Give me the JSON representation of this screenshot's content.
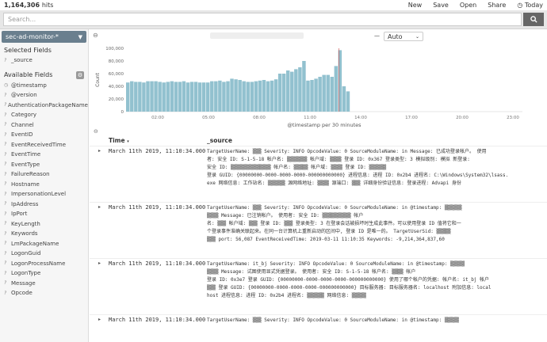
{
  "topbar": {
    "hits_count": "1,164,306",
    "hits_label": "hits",
    "menu": [
      "New",
      "Save",
      "Open",
      "Share"
    ],
    "time_label": "Today"
  },
  "search": {
    "placeholder": "Search..."
  },
  "sidebar": {
    "index_pattern": "sec-ad-monitor-*",
    "selected_heading": "Selected Fields",
    "selected_fields": [
      "_source"
    ],
    "available_heading": "Available Fields",
    "fields": [
      "@timestamp",
      "@version",
      "AuthenticationPackageName",
      "Category",
      "Channel",
      "EventID",
      "EventReceivedTime",
      "EventTime",
      "EventType",
      "FailureReason",
      "Hostname",
      "ImpersonationLevel",
      "IpAddress",
      "IpPort",
      "KeyLength",
      "Keywords",
      "LmPackageName",
      "LogonGuid",
      "LogonProcessName",
      "LogonType",
      "Message",
      "Opcode"
    ]
  },
  "toolbar": {
    "interval": "Auto"
  },
  "chart_data": {
    "type": "bar",
    "ylabel": "Count",
    "xlabel": "@timestamp per 30 minutes",
    "ylim": [
      0,
      100000
    ],
    "yticks": [
      "100,000",
      "80,000",
      "60,000",
      "40,000",
      "20,000",
      "0"
    ],
    "xticks": [
      "12:00",
      "14:00",
      "16:00",
      "18:00",
      "20:00",
      "22:00",
      "00:00",
      "02:00",
      "04:00",
      "06:00",
      "08:00",
      "10:00"
    ],
    "xtick_labels_shown": [
      "02:00",
      "05:00",
      "08:00",
      "11:00",
      "14:00",
      "17:00",
      "20:00",
      "23:00"
    ],
    "values": [
      46000,
      48000,
      47000,
      47000,
      46000,
      48000,
      48000,
      48000,
      47000,
      46000,
      47000,
      48000,
      47000,
      47000,
      48000,
      46000,
      47000,
      47000,
      46000,
      46000,
      46000,
      48000,
      48000,
      49000,
      47000,
      48000,
      52000,
      51000,
      50000,
      48000,
      47000,
      47000,
      48000,
      49000,
      50000,
      48000,
      49000,
      51000,
      60000,
      60000,
      65000,
      63000,
      67000,
      70000,
      80000,
      49000,
      50000,
      52000,
      55000,
      58000,
      58000,
      55000,
      72000,
      97000,
      40000,
      32000
    ]
  },
  "table": {
    "col_time": "Time",
    "col_source": "_source",
    "rows": [
      {
        "time": "March 11th 2019, 11:10:34.000",
        "lines": [
          "TargetUserName: ▒▒▒ Severity: INFO OpcodeValue: 0 SourceModuleName: in Message: 已成功登录帐户。 使用",
          "者: 安全 ID: S-1-5-18 帐户名: ▒▒▒▒▒▒▒ 帐户域: ▒▒▒▒ 登录 ID: 0x367 登录类型: 3 模拟级别: 模拟 新登录:",
          "安全 ID: ▒▒▒▒▒▒▒▒▒▒▒▒▒▒ 帐户名: ▒▒▒▒▒ 帐户域: ▒▒▒▒ 登录 ID: ▒▒▒▒▒▒",
          "登录 GUID: {00000000-0000-0000-0000-000000000000} 进程信息: 进程 ID: 0x2b4 进程名: C:\\Windows\\System32\\lsass.",
          "exe 网络信息: 工作站名: ▒▒▒▒▒▒ 源网络地址: ▒▒▒▒ 源端口: ▒▒▒ 详细身份验证信息: 登录进程: Advapi 身份"
        ]
      },
      {
        "time": "March 11th 2019, 11:10:34.000",
        "lines": [
          "TargetUserName: ▒▒▒ Severity: INFO OpcodeValue: 0 SourceModuleName: in @timestamp: ▒▒▒▒▒▒",
          "▒▒▒▒ Message: 已注销帐户。 使用者: 安全 ID: ▒▒▒▒▒▒▒▒▒▒ 帐户",
          "名: ▒▒▒ 帐户域: ▒▒▒ 登录 ID: ▒▒▒ 登录类型: 3 在登录会话被损坏时生成此事件。可以使用登录 ID 值将它和一",
          "个登录事件准确关联起来。在同一台计算机上重新启动的区间中, 登录 ID 是唯一的。 TargetUserSid: ▒▒▒▒▒",
          "▒▒▒ port: 56,087 EventReceivedTime: 2019-03-11 11:10:35 Keywords: -9,214,364,837,60"
        ]
      },
      {
        "time": "March 11th 2019, 11:10:34.000",
        "lines": [
          "TargetUserName: it_bj Severity: INFO OpcodeValue: 0 SourceModuleName: in @timestamp: ▒▒▒▒▒",
          "▒▒▒▒ Message: 试图使用显式凭据登录。 使用者: 安全 ID: S-1-5-18 帐户名: ▒▒▒▒ 帐户",
          "登录 ID: 0x3e7 登录 GUID: {00000000-0000-0000-0000-000000000000} 使用了哪个帐户的凭据: 帐户名: it_bj 帐户",
          "▒▒▒ 登录 GUID: {00000000-0000-0000-0000-000000000000} 目标服务器: 目标服务器名: localhost 附加信息: local",
          "host 进程信息: 进程 ID: 0x2b4 进程名: ▒▒▒▒▒▒ 网络信息: ▒▒▒▒▒"
        ]
      },
      {
        "time": "March 11th 2019, 11:10:34.000",
        "lines": [
          "TargetUserName: ▒▒▒ Severity: INFO OpcodeValue: 0 SourceModuleName: in @timestamp: ▒▒▒▒▒"
        ]
      }
    ]
  }
}
